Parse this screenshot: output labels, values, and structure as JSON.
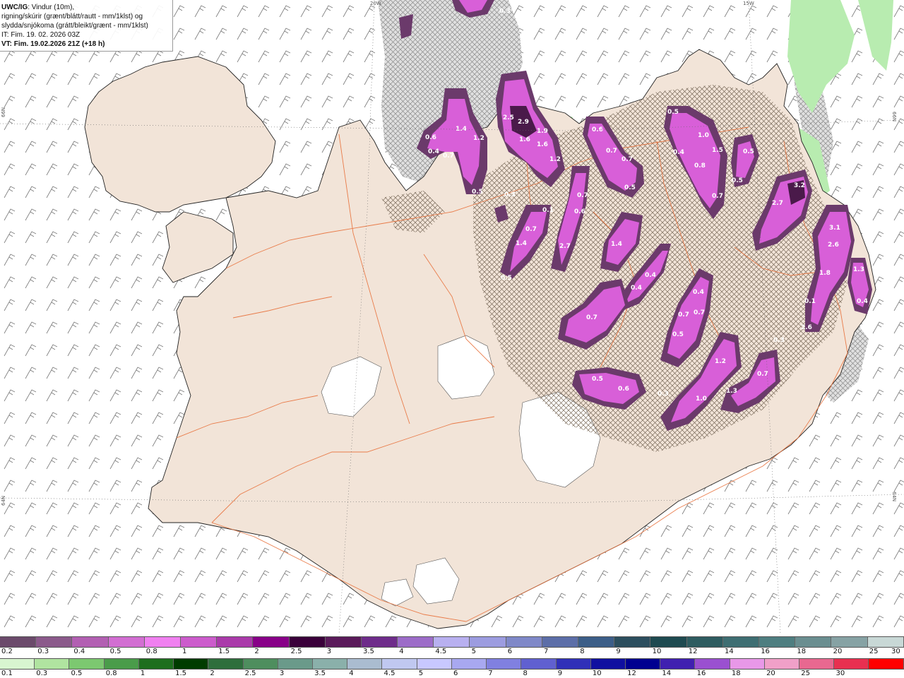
{
  "header": {
    "model": "UWC/IG",
    "line1_rest": ": Vindur (10m),",
    "line2": "rigning/skúrir (grænt/blátt/rautt - mm/1klst) og",
    "line3": "slydda/snjókoma (grátt/bleikt/grænt - mm/1klst)",
    "it": "IT: Fim. 19. 02. 2026 03Z",
    "vt": "VT: Fim. 19.02.2026 21Z (+18 h)"
  },
  "graticule": {
    "lon_20w": "20W",
    "lon_15w": "15W",
    "lat_66n_left": "66N",
    "lat_66n_right": "66N",
    "lat_64n_left": "64N",
    "lat_64n_right": "64N"
  },
  "precip_labels": [
    {
      "id": "a1",
      "text": "0.3"
    },
    {
      "id": "a2",
      "text": "1.4"
    },
    {
      "id": "a3",
      "text": "1.2"
    },
    {
      "id": "a4",
      "text": "0.6"
    },
    {
      "id": "a5",
      "text": "0.4"
    },
    {
      "id": "a6",
      "text": "0.7"
    },
    {
      "id": "a7",
      "text": "0.5"
    },
    {
      "id": "a8",
      "text": "2.5"
    },
    {
      "id": "a9",
      "text": "2.9"
    },
    {
      "id": "a10",
      "text": "1.9"
    },
    {
      "id": "a11",
      "text": "1.6"
    },
    {
      "id": "a12",
      "text": "1.6"
    },
    {
      "id": "a13",
      "text": "1.2"
    },
    {
      "id": "a14",
      "text": "0.6"
    },
    {
      "id": "a15",
      "text": "0.7"
    },
    {
      "id": "a16",
      "text": "0.7"
    },
    {
      "id": "a17",
      "text": "0.5"
    },
    {
      "id": "a18",
      "text": "0.5"
    },
    {
      "id": "a19",
      "text": "1.0"
    },
    {
      "id": "a20",
      "text": "1.5"
    },
    {
      "id": "a21",
      "text": "0.4"
    },
    {
      "id": "a22",
      "text": "0.8"
    },
    {
      "id": "a23",
      "text": "0.5"
    },
    {
      "id": "a24",
      "text": "0.7"
    },
    {
      "id": "a25",
      "text": "0.5"
    },
    {
      "id": "a26",
      "text": "0.7"
    },
    {
      "id": "a27",
      "text": "0.6"
    },
    {
      "id": "a28",
      "text": "0.7"
    },
    {
      "id": "a29",
      "text": "1.4"
    },
    {
      "id": "a30",
      "text": "2.7"
    },
    {
      "id": "a31",
      "text": "0.1"
    },
    {
      "id": "a32",
      "text": "1.4"
    },
    {
      "id": "a33",
      "text": "0.5"
    },
    {
      "id": "a34",
      "text": "0.4"
    },
    {
      "id": "a35",
      "text": "0.4"
    },
    {
      "id": "a36",
      "text": "0.7"
    },
    {
      "id": "a37",
      "text": "0.4"
    },
    {
      "id": "a38",
      "text": "0.7"
    },
    {
      "id": "a39",
      "text": "0.7"
    },
    {
      "id": "a40",
      "text": "0.5"
    },
    {
      "id": "a41",
      "text": "1.2"
    },
    {
      "id": "a42",
      "text": "0.5"
    },
    {
      "id": "a43",
      "text": "0.6"
    },
    {
      "id": "a44",
      "text": "0.3"
    },
    {
      "id": "a45",
      "text": "1.0"
    },
    {
      "id": "a46",
      "text": "1.3"
    },
    {
      "id": "a47",
      "text": "0.7"
    },
    {
      "id": "a48",
      "text": "0.3"
    },
    {
      "id": "a49",
      "text": "3.2"
    },
    {
      "id": "a50",
      "text": "2.7"
    },
    {
      "id": "a51",
      "text": "3.1"
    },
    {
      "id": "a52",
      "text": "2.6"
    },
    {
      "id": "a53",
      "text": "1.8"
    },
    {
      "id": "a54",
      "text": "1.3"
    },
    {
      "id": "a55",
      "text": "0.4"
    },
    {
      "id": "a56",
      "text": "0.1"
    },
    {
      "id": "a57",
      "text": "2.6"
    },
    {
      "id": "a58",
      "text": "0.3"
    }
  ],
  "legend_snow": {
    "ticks": [
      "0.2",
      "0.3",
      "0.4",
      "0.5",
      "0.8",
      "1",
      "1.5",
      "2",
      "2.5",
      "3",
      "3.5",
      "4",
      "4.5",
      "5",
      "6",
      "7",
      "8",
      "9",
      "10",
      "12",
      "14",
      "16",
      "18",
      "20",
      "25",
      "30"
    ],
    "colors": [
      "#6b4a6b",
      "#8b5a8b",
      "#b25fb2",
      "#d26ed2",
      "#f080f0",
      "#cc5ccc",
      "#aa3aaa",
      "#880088",
      "#3a003a",
      "#5a1a5a",
      "#6e2c8a",
      "#9c6cc8",
      "#b8b0f0",
      "#9c9ce0",
      "#7f88c8",
      "#5c6ea8",
      "#3c5e88",
      "#2c4e5e",
      "#1e4a50",
      "#2e5c60",
      "#3e6e72",
      "#4e7e80",
      "#6a8e90",
      "#86a2a4",
      "#c8d8d6"
    ]
  },
  "legend_rain": {
    "ticks": [
      "0.1",
      "0.3",
      "0.5",
      "0.8",
      "1",
      "1.5",
      "2",
      "2.5",
      "3",
      "3.5",
      "4",
      "4.5",
      "5",
      "6",
      "7",
      "8",
      "9",
      "10",
      "12",
      "14",
      "16",
      "18",
      "20",
      "25",
      "30"
    ],
    "colors": [
      "#d8f5d0",
      "#b0e4a0",
      "#7cc870",
      "#4a9c4a",
      "#1e6e1e",
      "#003c00",
      "#2e6e3c",
      "#4e8e5e",
      "#6a9a8a",
      "#8ab0aa",
      "#aabcd0",
      "#c0c8f0",
      "#c8c8ff",
      "#a8a8f0",
      "#8080e0",
      "#6060d0",
      "#3030b8",
      "#1010a0",
      "#000090",
      "#4020b0",
      "#9a50d0",
      "#e898e8",
      "#f0a0c8",
      "#e86890",
      "#e83050",
      "#ff0000"
    ]
  }
}
